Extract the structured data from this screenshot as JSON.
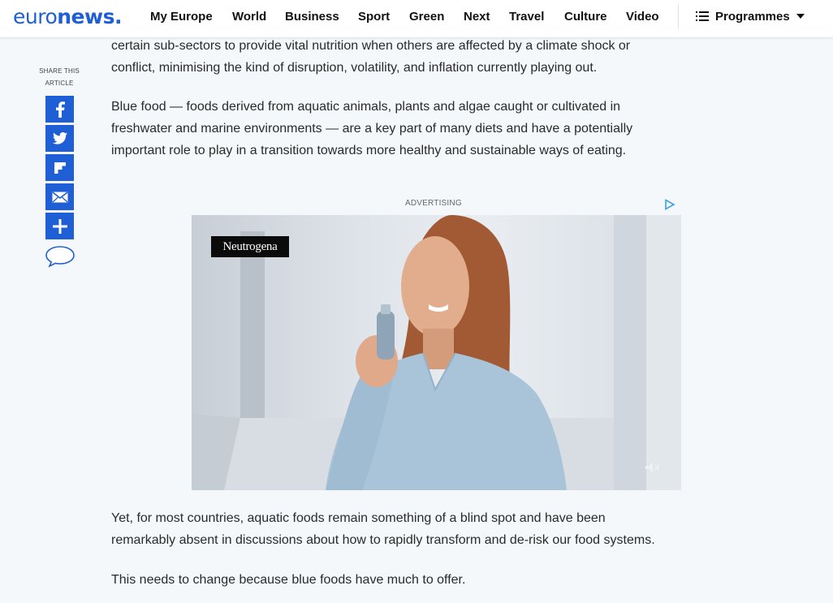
{
  "header": {
    "logo_part1": "euro",
    "logo_part2": "news",
    "logo_dot": ".",
    "nav": [
      "My Europe",
      "World",
      "Business",
      "Sport",
      "Green",
      "Next",
      "Travel",
      "Culture",
      "Video"
    ],
    "programmes_label": "Programmes"
  },
  "share": {
    "label_line1": "SHARE THIS",
    "label_line2": "ARTICLE",
    "buttons": [
      "facebook-icon",
      "twitter-icon",
      "flipboard-icon",
      "email-icon",
      "plus-icon",
      "comment-icon"
    ]
  },
  "article": {
    "p1": [
      "certain sub-sectors to provide vital nutrition when others are affected by a climate shock or",
      "conflict, minimising the kind of disruption, volatility, and inflation currently playing out."
    ],
    "p2": [
      "Blue food — foods derived from aquatic animals, plants and algae caught or cultivated in",
      "freshwater and marine environments — are a key part of many diets and have a potentially",
      "important role to play in a transition towards more healthy and sustainable ways of eating."
    ],
    "p3": [
      "Yet, for most countries, aquatic foods remain something of a blind spot and have been",
      "remarkably absent in discussions about how to rapidly transform and de-risk our food systems."
    ],
    "p4": [
      "This needs to change because blue foods have much to offer."
    ]
  },
  "ad": {
    "label": "ADVERTISING",
    "brand": "Neutrogena"
  },
  "colors": {
    "brand_blue": "#1f5fd6",
    "page_bg": "#f4f8fb"
  }
}
